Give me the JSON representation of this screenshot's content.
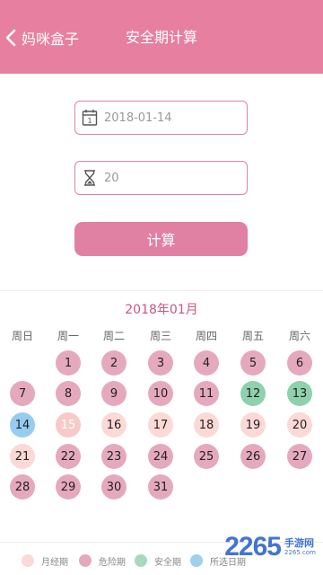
{
  "header": {
    "back_label": "妈咪盒子",
    "title": "安全期计算",
    "color": "#e67fa0"
  },
  "form": {
    "date_value": "2018-01-14",
    "cycle_value": "20",
    "calculate_label": "计算"
  },
  "calendar": {
    "month_title": "2018年01月",
    "weekdays": [
      "周日",
      "周一",
      "周二",
      "周三",
      "周四",
      "周五",
      "周六"
    ],
    "days": [
      {
        "d": "1",
        "type": "danger"
      },
      {
        "d": "2",
        "type": "danger"
      },
      {
        "d": "3",
        "type": "danger"
      },
      {
        "d": "4",
        "type": "danger"
      },
      {
        "d": "5",
        "type": "danger"
      },
      {
        "d": "6",
        "type": "danger"
      },
      {
        "d": "7",
        "type": "danger"
      },
      {
        "d": "8",
        "type": "danger"
      },
      {
        "d": "9",
        "type": "danger"
      },
      {
        "d": "10",
        "type": "danger"
      },
      {
        "d": "11",
        "type": "danger"
      },
      {
        "d": "12",
        "type": "safe"
      },
      {
        "d": "13",
        "type": "safe"
      },
      {
        "d": "14",
        "type": "selected"
      },
      {
        "d": "15",
        "type": "today"
      },
      {
        "d": "16",
        "type": "period"
      },
      {
        "d": "17",
        "type": "period"
      },
      {
        "d": "18",
        "type": "period"
      },
      {
        "d": "19",
        "type": "period"
      },
      {
        "d": "20",
        "type": "period"
      },
      {
        "d": "21",
        "type": "period"
      },
      {
        "d": "22",
        "type": "danger"
      },
      {
        "d": "23",
        "type": "danger"
      },
      {
        "d": "24",
        "type": "danger"
      },
      {
        "d": "25",
        "type": "danger"
      },
      {
        "d": "26",
        "type": "danger"
      },
      {
        "d": "27",
        "type": "danger"
      },
      {
        "d": "28",
        "type": "danger"
      },
      {
        "d": "29",
        "type": "danger"
      },
      {
        "d": "30",
        "type": "danger"
      },
      {
        "d": "31",
        "type": "danger"
      }
    ],
    "first_weekday_index": 1
  },
  "legend": [
    {
      "label": "月经期",
      "color": "#fbd9d7"
    },
    {
      "label": "危险期",
      "color": "#e5a9bd"
    },
    {
      "label": "安全期",
      "color": "#a6d9bd"
    },
    {
      "label": "所选日期",
      "color": "#9fd0ee"
    }
  ],
  "colors": {
    "period": "#fbd9d7",
    "danger": "#e5a9bd",
    "safe": "#8fd0ad",
    "selected": "#95cdf0",
    "today": "#f7c9c9",
    "accent": "#e080a2"
  },
  "watermark": {
    "number": "2265",
    "text": "手游网",
    "url": "2265.com"
  }
}
